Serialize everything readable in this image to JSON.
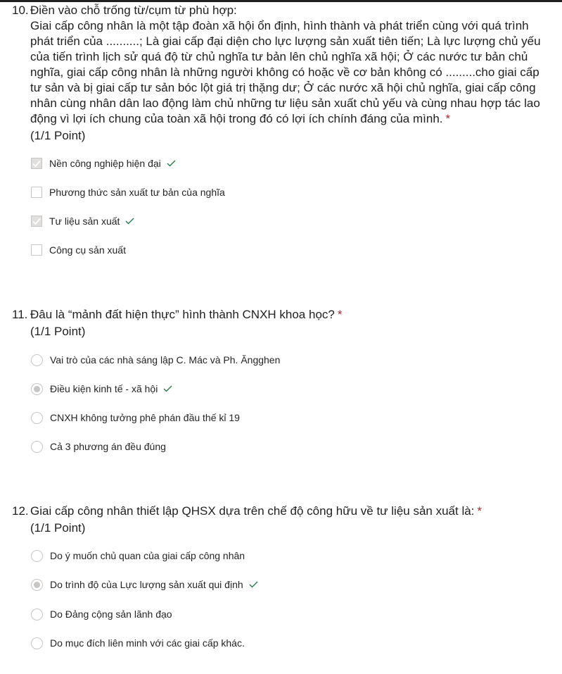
{
  "colors": {
    "required": "#a4262c",
    "correct": "#107c41",
    "muted": "#c8c6c4"
  },
  "q10": {
    "number": "10.",
    "lines": [
      "Điền vào chỗ trống  từ/cụm từ phù hợp:",
      "Giai cấp công nhân là một tập đoàn xã hội ổn định, hình thành và phát triển cùng với quá trình",
      "phát triển của ..........; Là giai cấp đại diện cho lực lượng sản xuất tiên tiến; Là lực lượng chủ yếu",
      "của tiến trình lịch sử quá độ từ chủ nghĩa tư bản lên chủ nghĩa xã hội; Ở các nước tư bản chủ",
      "nghĩa, giai cấp công nhân là những người không có hoặc về cơ bản không có .........cho giai cấp",
      "tư sản và bị giai cấp tư sản bóc lột giá trị thặng dư; Ở các nước xã hội chủ nghĩa, giai cấp công",
      "nhân cùng nhân dân lao động làm chủ những tư liệu sản xuất chủ yếu và cùng nhau hợp tác lao",
      "động vì lợi ích chung của toàn xã hội trong đó có lợi ích chính đáng của mình."
    ],
    "required_mark": "*",
    "points": "(1/1 Point)",
    "options": [
      {
        "label": "Nền công nghiệp hiện đại",
        "checked": true,
        "correct": true
      },
      {
        "label": "Phương thức sản xuất tư bản của nghĩa",
        "checked": false,
        "correct": false
      },
      {
        "label": "Tư liệu sản xuất",
        "checked": true,
        "correct": true
      },
      {
        "label": "Công cụ sản xuất",
        "checked": false,
        "correct": false
      }
    ]
  },
  "q11": {
    "number": "11.",
    "title": " Đâu là “mảnh đất hiện thực” hình thành CNXH khoa học?",
    "required_mark": "*",
    "points": "(1/1 Point)",
    "options": [
      {
        "label": "Vai trò của các nhà sáng lập C. Mác và Ph. Ăngghen",
        "checked": false,
        "correct": false
      },
      {
        "label": "Điều kiện kinh tế - xã hội",
        "checked": true,
        "correct": true
      },
      {
        "label": "CNXH không tưởng phê phán đầu thế kỉ 19",
        "checked": false,
        "correct": false
      },
      {
        "label": "Cả 3 phương án đều đúng",
        "checked": false,
        "correct": false
      }
    ]
  },
  "q12": {
    "number": "12.",
    "title": "Giai cấp công nhân thiết lập QHSX dựa trên chế độ công hữu về tư liệu sản xuất là:",
    "required_mark": "*",
    "points": "(1/1 Point)",
    "options": [
      {
        "label": "Do ý muốn chủ quan của giai cấp công nhân",
        "checked": false,
        "correct": false
      },
      {
        "label": "Do trình độ của Lực lượng sản xuất qui định",
        "checked": true,
        "correct": true
      },
      {
        "label": "Do Đảng cộng sản lãnh đạo",
        "checked": false,
        "correct": false
      },
      {
        "label": "Do mục đích liên minh với các giai cấp khác.",
        "checked": false,
        "correct": false
      }
    ]
  }
}
